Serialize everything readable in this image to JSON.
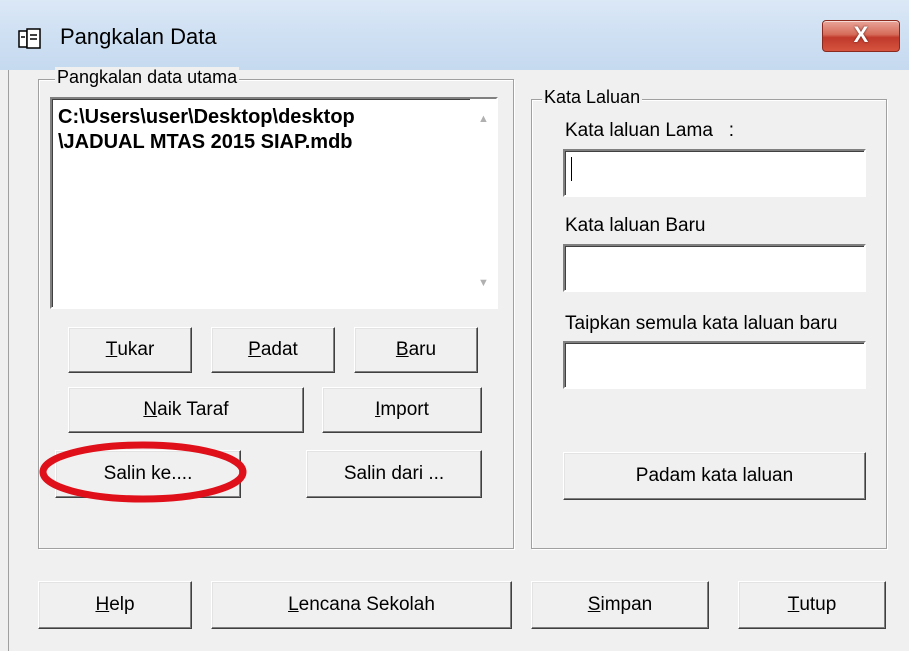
{
  "window": {
    "title": "Pangkalan Data",
    "close_label": "X"
  },
  "left_group": {
    "legend": "Pangkalan data utama",
    "path_line1": "C:\\Users\\user\\Desktop\\desktop",
    "path_line2": "\\JADUAL MTAS 2015 SIAP.mdb",
    "buttons": {
      "tukar": {
        "mn": "T",
        "rest": "ukar"
      },
      "padat": {
        "mn": "P",
        "rest": "adat"
      },
      "baru": {
        "mn": "B",
        "rest": "aru"
      },
      "naik_taraf": {
        "mn": "N",
        "rest": "aik Taraf"
      },
      "import": {
        "pre": "",
        "mn": "I",
        "rest": "mport"
      },
      "salin_ke": "Salin ke....",
      "salin_dari": "Salin dari ..."
    }
  },
  "right_group": {
    "legend": "Kata Laluan",
    "old_label": "Kata laluan Lama   :",
    "new_label": "Kata laluan Baru",
    "retype_label": "Taipkan semula kata laluan baru",
    "delete_button": "Padam kata laluan"
  },
  "bottom": {
    "help": {
      "mn": "H",
      "rest": "elp"
    },
    "lencana": {
      "mn": "L",
      "rest": "encana Sekolah"
    },
    "simpan": {
      "mn": "S",
      "rest": "impan"
    },
    "tutup": {
      "mn": "T",
      "rest": "utup"
    }
  },
  "annotation_color": "#e0101a"
}
